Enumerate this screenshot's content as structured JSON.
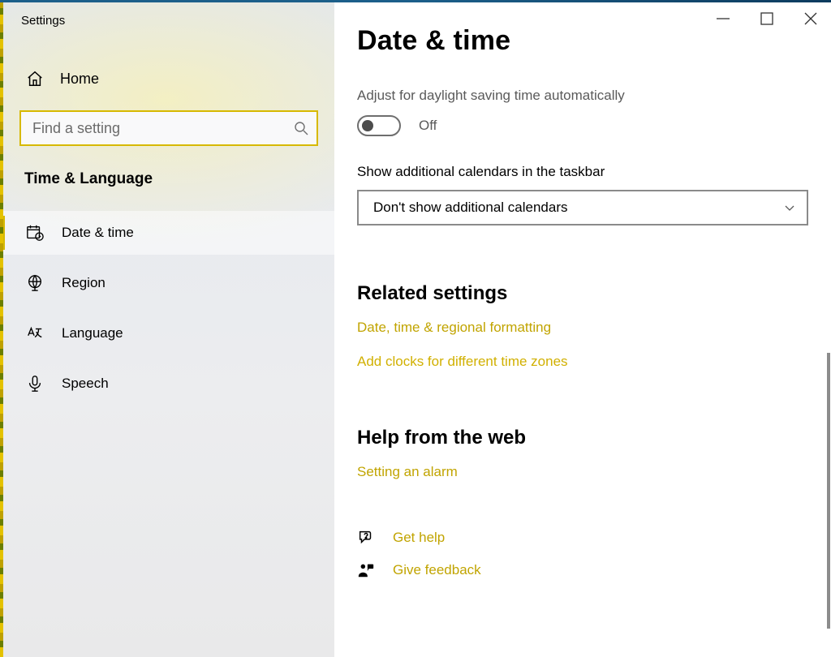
{
  "app_title": "Settings",
  "window": {
    "minimize": "minimize",
    "maximize": "maximize",
    "close": "close"
  },
  "home_label": "Home",
  "search": {
    "placeholder": "Find a setting"
  },
  "category_heading": "Time & Language",
  "nav": [
    {
      "label": "Date & time",
      "active": true
    },
    {
      "label": "Region",
      "active": false
    },
    {
      "label": "Language",
      "active": false
    },
    {
      "label": "Speech",
      "active": false
    }
  ],
  "page": {
    "title": "Date & time",
    "dst": {
      "label": "Adjust for daylight saving time automatically",
      "state": "Off"
    },
    "calendars": {
      "label": "Show additional calendars in the taskbar",
      "selected": "Don't show additional calendars"
    },
    "related": {
      "heading": "Related settings",
      "links": [
        "Date, time & regional formatting",
        "Add clocks for different time zones"
      ]
    },
    "help": {
      "heading": "Help from the web",
      "links": [
        "Setting an alarm"
      ]
    },
    "assist": {
      "get_help": "Get help",
      "give_feedback": "Give feedback"
    }
  },
  "accent_color": "#d7b900"
}
